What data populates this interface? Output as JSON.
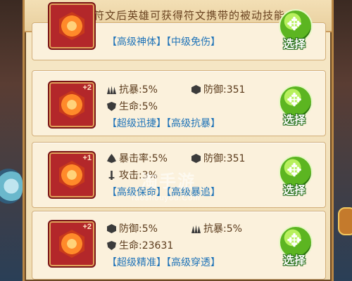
{
  "header": {
    "title": "穿戴符文后英雄可获得符文携带的被动技能"
  },
  "cards": [
    {
      "level": "",
      "stats": [],
      "tags": [
        "【高级神体】",
        "【中级免伤】"
      ],
      "button": "选择"
    },
    {
      "level": "+2",
      "stats": [
        {
          "label": "抗暴:5%",
          "icon": "claw-icon"
        },
        {
          "label": "防御:351",
          "icon": "hex-shield-icon"
        },
        {
          "label": "生命:5%",
          "icon": "hex-heart-icon"
        }
      ],
      "tags": [
        "【超级迅捷】",
        "【高级抗暴】"
      ],
      "button": "选择"
    },
    {
      "level": "+1",
      "stats": [
        {
          "label": "暴击率:5%",
          "icon": "fire-icon"
        },
        {
          "label": "防御:351",
          "icon": "hex-shield-icon"
        },
        {
          "label": "攻击:3%",
          "icon": "sword-icon"
        }
      ],
      "tags": [
        "【高级保命】",
        "【高级暴追】"
      ],
      "button": "选择"
    },
    {
      "level": "+2",
      "stats": [
        {
          "label": "防御:5%",
          "icon": "hex-shield-icon"
        },
        {
          "label": "抗暴:5%",
          "icon": "claw-icon"
        },
        {
          "label": "生命:23631",
          "icon": "hex-heart-icon"
        }
      ],
      "tags": [
        "【超级精准】",
        "【高级穿透】"
      ],
      "button": "选择"
    }
  ],
  "watermark": {
    "text": "淘手游",
    "sub": "Taoshouyou.Com"
  }
}
